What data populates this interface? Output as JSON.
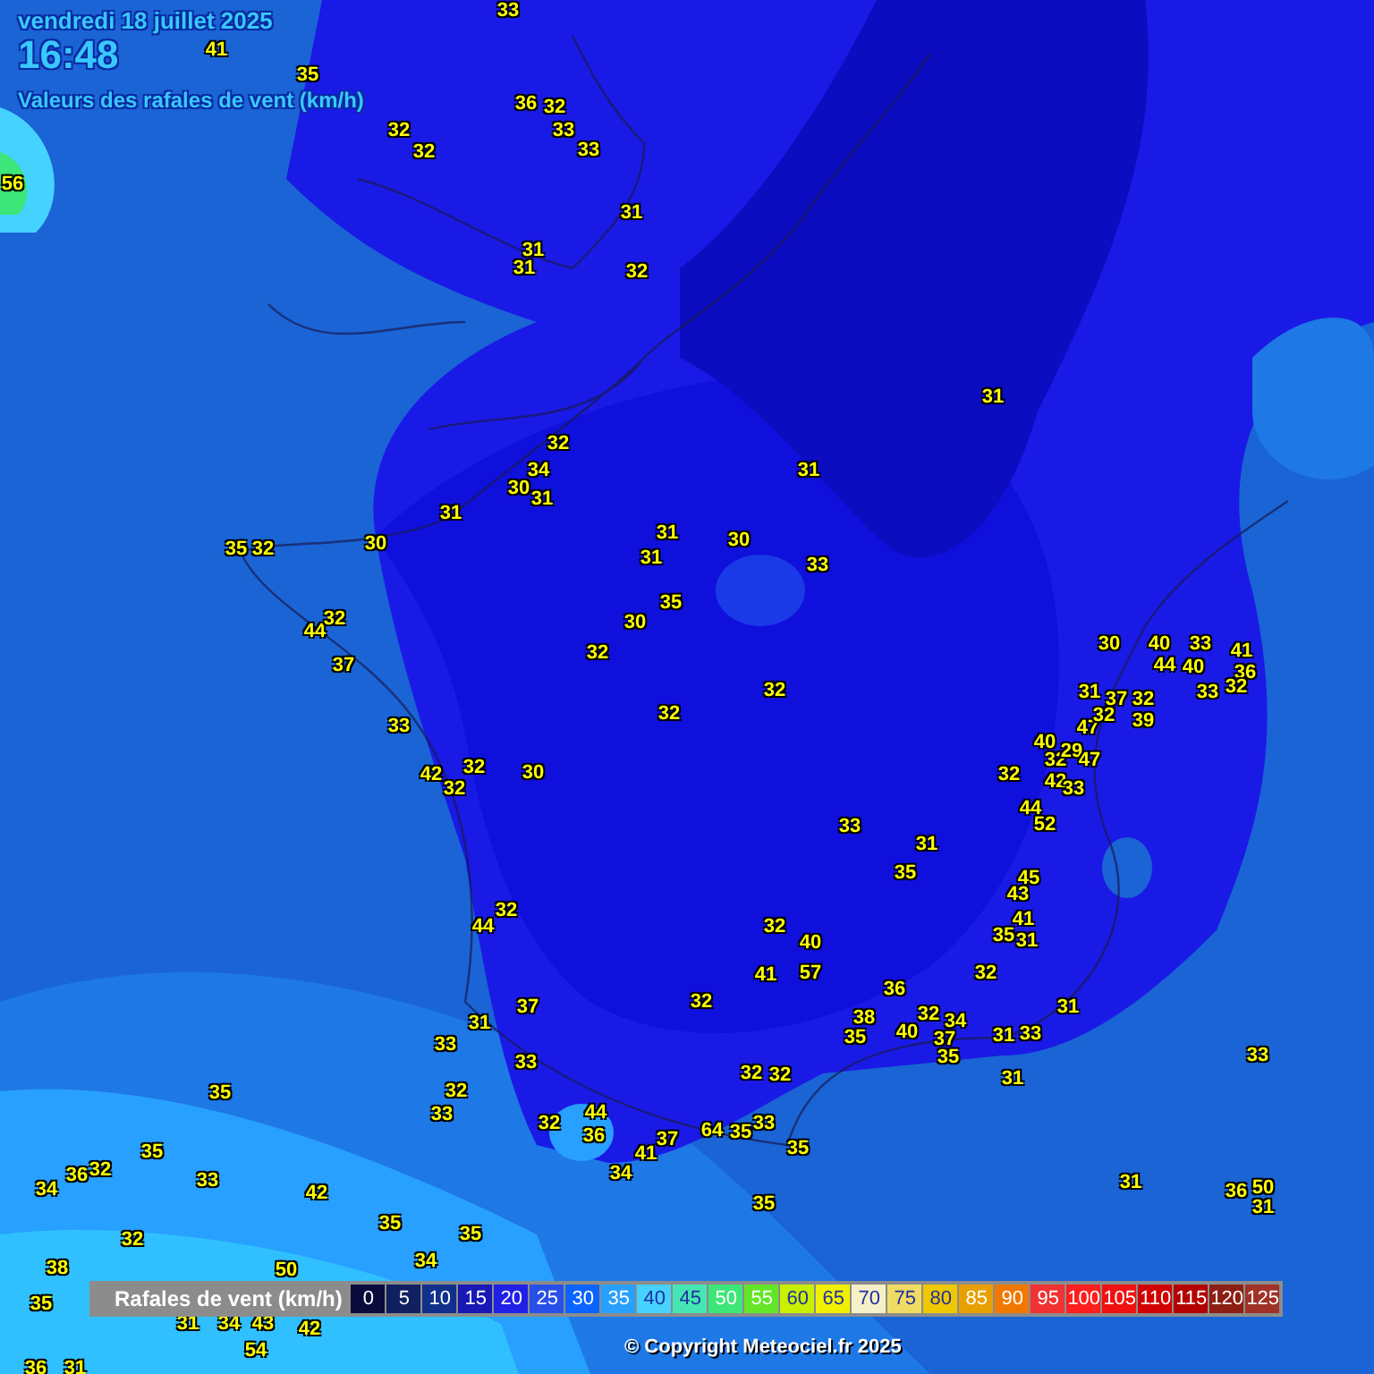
{
  "header": {
    "date": "vendredi 18 juillet 2025",
    "time": "16:48",
    "title": "Valeurs des rafales de vent (km/h)"
  },
  "stations": [
    {
      "value": "33"
    },
    {
      "value": "41"
    },
    {
      "value": "35"
    },
    {
      "value": "36"
    },
    {
      "value": "32"
    },
    {
      "value": "32"
    },
    {
      "value": "33"
    },
    {
      "value": "32"
    },
    {
      "value": "33"
    },
    {
      "value": "56"
    },
    {
      "value": "31"
    },
    {
      "value": "31"
    },
    {
      "value": "31"
    },
    {
      "value": "32"
    },
    {
      "value": "31"
    },
    {
      "value": "32"
    },
    {
      "value": "34"
    },
    {
      "value": "31"
    },
    {
      "value": "30"
    },
    {
      "value": "31"
    },
    {
      "value": "31"
    },
    {
      "value": "35"
    },
    {
      "value": "32"
    },
    {
      "value": "30"
    },
    {
      "value": "31"
    },
    {
      "value": "30"
    },
    {
      "value": "31"
    },
    {
      "value": "33"
    },
    {
      "value": "35"
    },
    {
      "value": "44"
    },
    {
      "value": "32"
    },
    {
      "value": "30"
    },
    {
      "value": "32"
    },
    {
      "value": "30"
    },
    {
      "value": "40"
    },
    {
      "value": "33"
    },
    {
      "value": "41"
    },
    {
      "value": "37"
    },
    {
      "value": "44"
    },
    {
      "value": "40"
    },
    {
      "value": "36"
    },
    {
      "value": "32"
    },
    {
      "value": "31"
    },
    {
      "value": "37"
    },
    {
      "value": "32"
    },
    {
      "value": "33"
    },
    {
      "value": "32"
    },
    {
      "value": "33"
    },
    {
      "value": "32"
    },
    {
      "value": "47"
    },
    {
      "value": "32"
    },
    {
      "value": "39"
    },
    {
      "value": "40"
    },
    {
      "value": "32"
    },
    {
      "value": "29"
    },
    {
      "value": "47"
    },
    {
      "value": "42"
    },
    {
      "value": "32"
    },
    {
      "value": "32"
    },
    {
      "value": "30"
    },
    {
      "value": "32"
    },
    {
      "value": "42"
    },
    {
      "value": "33"
    },
    {
      "value": "44"
    },
    {
      "value": "33"
    },
    {
      "value": "52"
    },
    {
      "value": "31"
    },
    {
      "value": "35"
    },
    {
      "value": "45"
    },
    {
      "value": "43"
    },
    {
      "value": "32"
    },
    {
      "value": "44"
    },
    {
      "value": "32"
    },
    {
      "value": "41"
    },
    {
      "value": "40"
    },
    {
      "value": "35"
    },
    {
      "value": "31"
    },
    {
      "value": "41"
    },
    {
      "value": "57"
    },
    {
      "value": "32"
    },
    {
      "value": "36"
    },
    {
      "value": "37"
    },
    {
      "value": "32"
    },
    {
      "value": "31"
    },
    {
      "value": "31"
    },
    {
      "value": "38"
    },
    {
      "value": "32"
    },
    {
      "value": "34"
    },
    {
      "value": "33"
    },
    {
      "value": "35"
    },
    {
      "value": "40"
    },
    {
      "value": "37"
    },
    {
      "value": "31"
    },
    {
      "value": "33"
    },
    {
      "value": "33"
    },
    {
      "value": "35"
    },
    {
      "value": "33"
    },
    {
      "value": "32"
    },
    {
      "value": "32"
    },
    {
      "value": "31"
    },
    {
      "value": "35"
    },
    {
      "value": "32"
    },
    {
      "value": "33"
    },
    {
      "value": "32"
    },
    {
      "value": "44"
    },
    {
      "value": "33"
    },
    {
      "value": "36"
    },
    {
      "value": "37"
    },
    {
      "value": "64"
    },
    {
      "value": "35"
    },
    {
      "value": "35"
    },
    {
      "value": "41"
    },
    {
      "value": "35"
    },
    {
      "value": "34"
    },
    {
      "value": "36"
    },
    {
      "value": "32"
    },
    {
      "value": "33"
    },
    {
      "value": "42"
    },
    {
      "value": "34"
    },
    {
      "value": "31"
    },
    {
      "value": "36"
    },
    {
      "value": "50"
    },
    {
      "value": "35"
    },
    {
      "value": "31"
    },
    {
      "value": "32"
    },
    {
      "value": "35"
    },
    {
      "value": "35"
    },
    {
      "value": "38"
    },
    {
      "value": "50"
    },
    {
      "value": "34"
    },
    {
      "value": "35"
    },
    {
      "value": "31"
    },
    {
      "value": "34"
    },
    {
      "value": "43"
    },
    {
      "value": "42"
    },
    {
      "value": "54"
    },
    {
      "value": "36"
    },
    {
      "value": "31"
    }
  ],
  "legend": {
    "title": "Rafales de vent (km/h)",
    "steps": [
      {
        "label": "0",
        "color": "#0a0a3c"
      },
      {
        "label": "5",
        "color": "#102060"
      },
      {
        "label": "10",
        "color": "#10308c"
      },
      {
        "label": "15",
        "color": "#1818b4"
      },
      {
        "label": "20",
        "color": "#2020e6"
      },
      {
        "label": "25",
        "color": "#2850e8"
      },
      {
        "label": "30",
        "color": "#0a64ff"
      },
      {
        "label": "35",
        "color": "#28a0ff"
      },
      {
        "label": "40",
        "color": "#46d2ff"
      },
      {
        "label": "45",
        "color": "#46e6b4"
      },
      {
        "label": "50",
        "color": "#3ce678"
      },
      {
        "label": "55",
        "color": "#64e628"
      },
      {
        "label": "60",
        "color": "#c8f000"
      },
      {
        "label": "65",
        "color": "#f0f000"
      },
      {
        "label": "70",
        "color": "#f5f0c8"
      },
      {
        "label": "75",
        "color": "#f0dc64"
      },
      {
        "label": "80",
        "color": "#f0c800"
      },
      {
        "label": "85",
        "color": "#e6a000"
      },
      {
        "label": "90",
        "color": "#f07800"
      },
      {
        "label": "95",
        "color": "#f03232"
      },
      {
        "label": "100",
        "color": "#ff1e1e"
      },
      {
        "label": "105",
        "color": "#f01010"
      },
      {
        "label": "110",
        "color": "#d20000"
      },
      {
        "label": "115",
        "color": "#b40000"
      },
      {
        "label": "120",
        "color": "#8c1e14"
      },
      {
        "label": "125",
        "color": "#a03228"
      }
    ]
  },
  "copyright": "© Copyright Meteociel.fr 2025"
}
